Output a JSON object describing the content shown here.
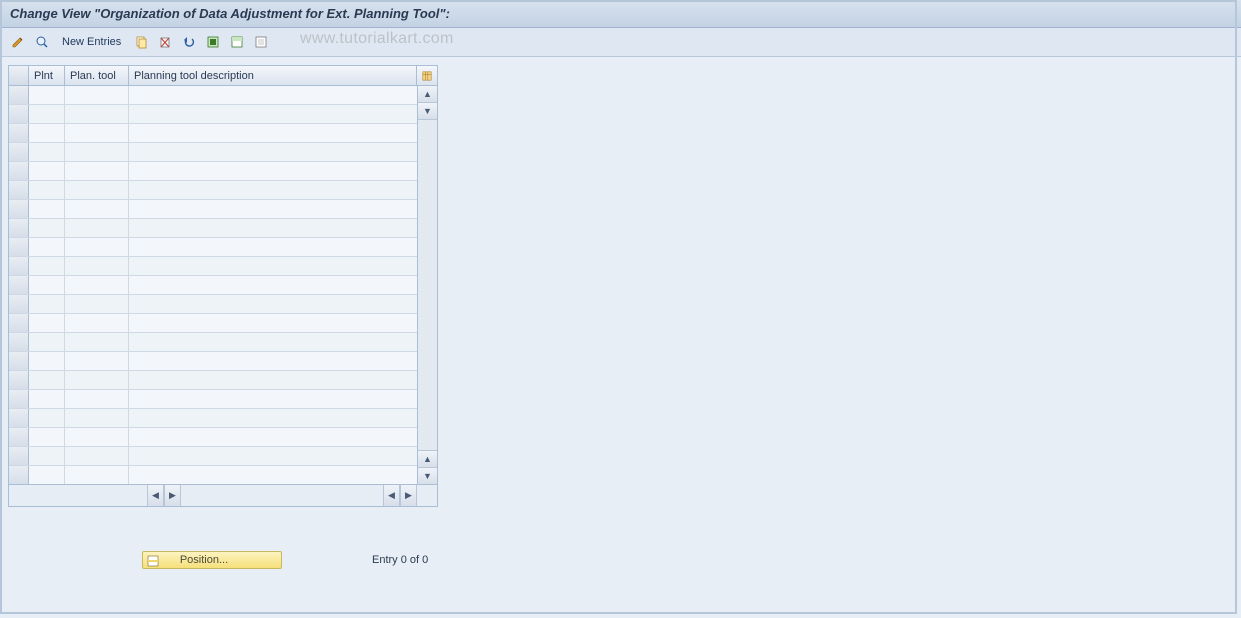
{
  "title": "Change View \"Organization of Data Adjustment for Ext. Planning Tool\":",
  "toolbar": {
    "new_entries_label": "New Entries"
  },
  "watermark": "www.tutorialkart.com",
  "grid": {
    "columns": {
      "plnt": "Plnt",
      "plan_tool": "Plan. tool",
      "description": "Planning tool description"
    },
    "row_count": 21
  },
  "footer": {
    "position_label": "Position...",
    "entry_status": "Entry 0 of 0"
  }
}
